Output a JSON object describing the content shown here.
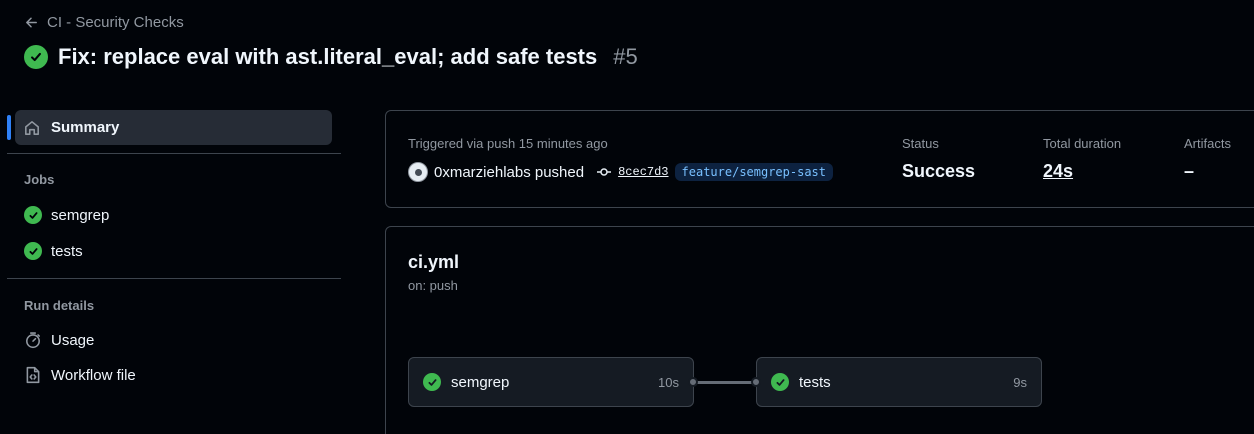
{
  "header": {
    "back_label": "CI - Security Checks",
    "title": "Fix: replace eval with ast.literal_eval; add safe tests",
    "run_number": "#5"
  },
  "sidebar": {
    "summary_label": "Summary",
    "jobs_heading": "Jobs",
    "jobs": [
      {
        "label": "semgrep",
        "status": "success"
      },
      {
        "label": "tests",
        "status": "success"
      }
    ],
    "run_details_heading": "Run details",
    "usage_label": "Usage",
    "workflow_file_label": "Workflow file"
  },
  "summary": {
    "trigger_text": "Triggered via push 15 minutes ago",
    "actor": "0xmarziehlabs pushed",
    "commit_sha": "8cec7d3",
    "branch": "feature/semgrep-sast",
    "status_label": "Status",
    "status_value": "Success",
    "duration_label": "Total duration",
    "duration_value": "24s",
    "artifacts_label": "Artifacts",
    "artifacts_value": "–"
  },
  "workflow": {
    "file_name": "ci.yml",
    "trigger": "on: push",
    "jobs": [
      {
        "name": "semgrep",
        "duration": "10s"
      },
      {
        "name": "tests",
        "duration": "9s"
      }
    ]
  },
  "colors": {
    "background": "#010409",
    "success": "#3fb950",
    "accent": "#2f81f7",
    "branch_text": "#79c0ff"
  }
}
